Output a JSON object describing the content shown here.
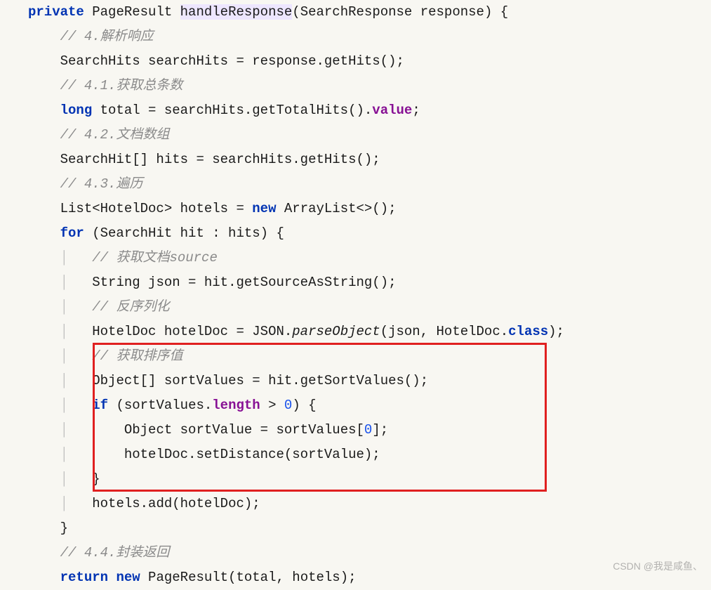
{
  "code": {
    "l1_kw1": "private",
    "l1_type": "PageResult ",
    "l1_method": "handleResponse",
    "l1_params": "(SearchResponse response) {",
    "l2": "// 4.解析响应",
    "l3a": "SearchHits searchHits = response.getHits();",
    "l4": "// 4.1.获取总条数",
    "l5_kw": "long",
    "l5a": " total = searchHits.getTotalHits().",
    "l5_field": "value",
    "l5b": ";",
    "l6": "// 4.2.文档数组",
    "l7": "SearchHit[] hits = searchHits.getHits();",
    "l8": "// 4.3.遍历",
    "l9a": "List<HotelDoc> hotels = ",
    "l9_kw": "new",
    "l9b": " ArrayList<>();",
    "l10_kw": "for",
    "l10a": " (SearchHit hit : hits) {",
    "l11": "// 获取文档source",
    "l12": "String json = hit.getSourceAsString();",
    "l13": "// 反序列化",
    "l14a": "HotelDoc hotelDoc = JSON.",
    "l14_m": "parseObject",
    "l14b": "(json, HotelDoc.",
    "l14_kw": "class",
    "l14c": ");",
    "l15": "// 获取排序值",
    "l16": "Object[] sortValues = hit.getSortValues();",
    "l17_kw": "if",
    "l17a": " (sortValues.",
    "l17_field": "length",
    "l17b": " > ",
    "l17_num": "0",
    "l17c": ") {",
    "l18a": "Object sortValue = sortValues[",
    "l18_num": "0",
    "l18b": "];",
    "l19": "hotelDoc.setDistance(sortValue);",
    "l20": "}",
    "l21": "hotels.add(hotelDoc);",
    "l22": "}",
    "l23": "// 4.4.封装返回",
    "l24_kw1": "return",
    "l24_sp": " ",
    "l24_kw2": "new",
    "l24a": " PageResult(total, hotels);"
  },
  "watermark": "CSDN @我是咸鱼、"
}
